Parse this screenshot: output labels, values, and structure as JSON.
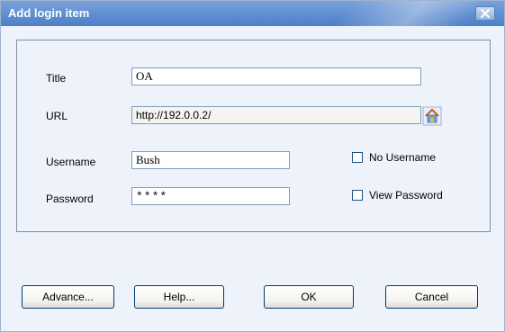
{
  "window": {
    "title": "Add login item"
  },
  "form": {
    "title_label": "Title",
    "title_value": "OA",
    "url_label": "URL",
    "url_value": "http://192.0.0.2/",
    "username_label": "Username",
    "username_value": "Bush",
    "password_label": "Password",
    "password_value": "****",
    "no_username_label": "No Username",
    "no_username_checked": false,
    "view_password_label": "View Password",
    "view_password_checked": false
  },
  "buttons": {
    "advance": "Advance...",
    "help": "Help...",
    "ok": "OK",
    "cancel": "Cancel"
  },
  "icons": {
    "url_button": "house-icon",
    "close": "close-icon"
  },
  "colors": {
    "titlebar": "#5f8ed1",
    "dialog_bg": "#eef3fb",
    "button_border": "#003c74",
    "url_field_bg": "#f4f4f0"
  }
}
